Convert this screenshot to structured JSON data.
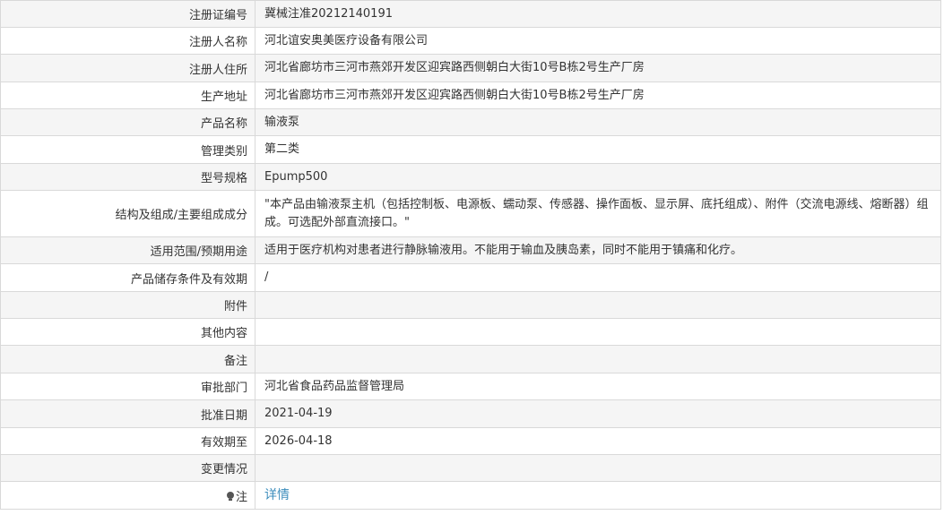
{
  "rows": [
    {
      "label": "注册证编号",
      "value": "冀械注准20212140191"
    },
    {
      "label": "注册人名称",
      "value": "河北谊安奥美医疗设备有限公司"
    },
    {
      "label": "注册人住所",
      "value": "河北省廊坊市三河市燕郊开发区迎宾路西侧朝白大街10号B栋2号生产厂房"
    },
    {
      "label": "生产地址",
      "value": "河北省廊坊市三河市燕郊开发区迎宾路西侧朝白大街10号B栋2号生产厂房"
    },
    {
      "label": "产品名称",
      "value": "输液泵"
    },
    {
      "label": "管理类别",
      "value": "第二类"
    },
    {
      "label": "型号规格",
      "value": "Epump500"
    },
    {
      "label": "结构及组成/主要组成成分",
      "value": "\"本产品由输液泵主机（包括控制板、电源板、蠕动泵、传感器、操作面板、显示屏、底托组成）、附件（交流电源线、熔断器）组成。可选配外部直流接口。\""
    },
    {
      "label": "适用范围/预期用途",
      "value": "适用于医疗机构对患者进行静脉输液用。不能用于输血及胰岛素，同时不能用于镇痛和化疗。"
    },
    {
      "label": "产品储存条件及有效期",
      "value": "/"
    },
    {
      "label": "附件",
      "value": ""
    },
    {
      "label": "其他内容",
      "value": ""
    },
    {
      "label": "备注",
      "value": ""
    },
    {
      "label": "审批部门",
      "value": "河北省食品药品监督管理局"
    },
    {
      "label": "批准日期",
      "value": "2021-04-19"
    },
    {
      "label": "有效期至",
      "value": "2026-04-18"
    },
    {
      "label": "变更情况",
      "value": ""
    }
  ],
  "note": {
    "icon": "lightbulb-icon",
    "label": "注",
    "link_text": "详情"
  },
  "colors": {
    "border": "#d9d9d9",
    "odd_row": "#f5f5f5",
    "link": "#3c8dbc"
  }
}
